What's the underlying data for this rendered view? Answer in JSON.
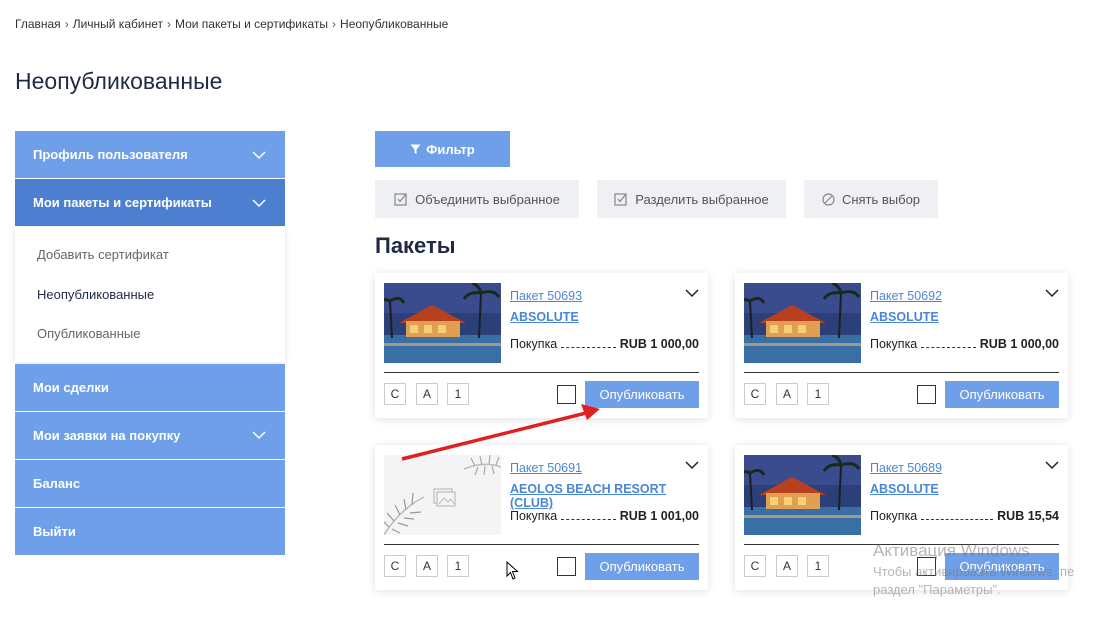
{
  "breadcrumb": [
    "Главная",
    "Личный кабинет",
    "Мои пакеты и сертификаты",
    "Неопубликованные"
  ],
  "page_title": "Неопубликованные",
  "sidebar": {
    "items": [
      {
        "label": "Профиль пользователя",
        "has_chevron": true,
        "active": false
      },
      {
        "label": "Мои пакеты и сертификаты",
        "has_chevron": true,
        "active": true
      },
      {
        "label": "Мои сделки",
        "has_chevron": false
      },
      {
        "label": "Мои заявки на покупку",
        "has_chevron": true
      },
      {
        "label": "Баланс",
        "has_chevron": false
      },
      {
        "label": "Выйти",
        "has_chevron": false
      }
    ],
    "submenu": [
      "Добавить сертификат",
      "Неопубликованные",
      "Опубликованные"
    ]
  },
  "toolbar": {
    "filter_label": "Фильтр",
    "merge_label": "Объединить выбранное",
    "split_label": "Разделить выбранное",
    "clear_label": "Снять выбор"
  },
  "section_title": "Пакеты",
  "cards": [
    {
      "pack": "Пакет 50693",
      "name": "ABSOLUTE",
      "price_label": "Покупка",
      "price": "RUB 1 000,00",
      "tags": [
        "С",
        "А",
        "1"
      ],
      "publish_label": "Опубликовать",
      "image": "resort-photo"
    },
    {
      "pack": "Пакет 50692",
      "name": "ABSOLUTE",
      "price_label": "Покупка",
      "price": "RUB 1 000,00",
      "tags": [
        "С",
        "А",
        "1"
      ],
      "publish_label": "Опубликовать",
      "image": "resort-photo"
    },
    {
      "pack": "Пакет 50691",
      "name": "AEOLOS BEACH RESORT (CLUB)",
      "price_label": "Покупка",
      "price": "RUB 1 001,00",
      "tags": [
        "С",
        "А",
        "1"
      ],
      "publish_label": "Опубликовать",
      "image": "placeholder-palm"
    },
    {
      "pack": "Пакет 50689",
      "name": "ABSOLUTE",
      "price_label": "Покупка",
      "price": "RUB 15,54",
      "tags": [
        "С",
        "А",
        "1"
      ],
      "publish_label": "Опубликовать",
      "image": "resort-photo"
    }
  ],
  "watermark": {
    "title": "Активация Windows",
    "line1": "Чтобы активировать Windows, пе",
    "line2": "раздел \"Параметры\"."
  },
  "colors": {
    "accent": "#6e9fe8",
    "accent_dark": "#4d7fd0",
    "link": "#4a86d6",
    "annotation_arrow": "#e02020"
  }
}
